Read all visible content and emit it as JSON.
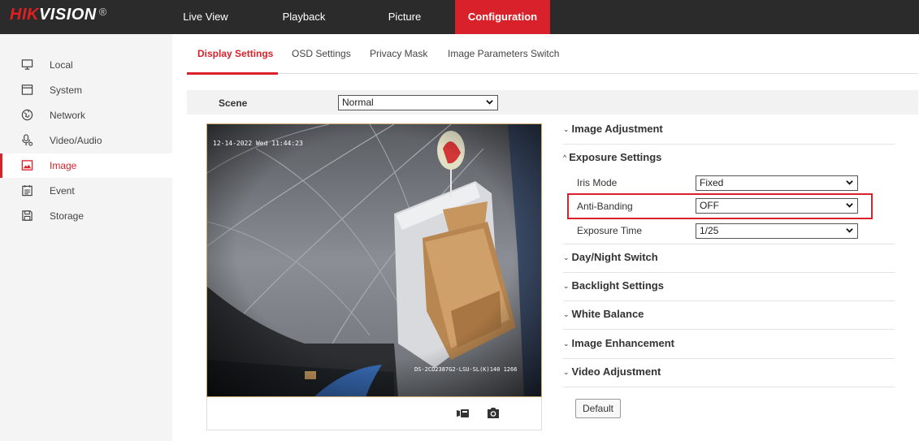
{
  "brand": {
    "hik": "HIK",
    "vision": "VISION",
    "reg": "®"
  },
  "topnav": [
    {
      "label": "Live View"
    },
    {
      "label": "Playback"
    },
    {
      "label": "Picture"
    },
    {
      "label": "Configuration"
    }
  ],
  "sidebar": {
    "items": [
      {
        "label": "Local",
        "icon": "monitor-icon"
      },
      {
        "label": "System",
        "icon": "system-icon"
      },
      {
        "label": "Network",
        "icon": "network-icon"
      },
      {
        "label": "Video/Audio",
        "icon": "video-audio-icon"
      },
      {
        "label": "Image",
        "icon": "image-icon"
      },
      {
        "label": "Event",
        "icon": "event-icon"
      },
      {
        "label": "Storage",
        "icon": "storage-icon"
      }
    ]
  },
  "subtabs": [
    {
      "label": "Display Settings"
    },
    {
      "label": "OSD Settings"
    },
    {
      "label": "Privacy Mask"
    },
    {
      "label": "Image Parameters Switch"
    }
  ],
  "scene": {
    "label": "Scene",
    "value": "Normal"
  },
  "video": {
    "osd_time": "12-14-2022 Wed 11:44:23",
    "osd_device": "DS-2CD2387G2-LSU-SL(K)140 1266"
  },
  "sections": {
    "image_adjustment": "Image Adjustment",
    "exposure_settings": "Exposure Settings",
    "day_night": "Day/Night Switch",
    "backlight": "Backlight Settings",
    "white_balance": "White Balance",
    "image_enhancement": "Image Enhancement",
    "video_adjustment": "Video Adjustment"
  },
  "exposure": {
    "iris_mode": {
      "label": "Iris Mode",
      "value": "Fixed"
    },
    "anti_banding": {
      "label": "Anti-Banding",
      "value": "OFF"
    },
    "exposure_time": {
      "label": "Exposure Time",
      "value": "1/25"
    }
  },
  "buttons": {
    "default": "Default"
  },
  "colors": {
    "accent": "#d8212a",
    "topbar": "#2b2b2b",
    "sidebar": "#f4f4f4"
  }
}
